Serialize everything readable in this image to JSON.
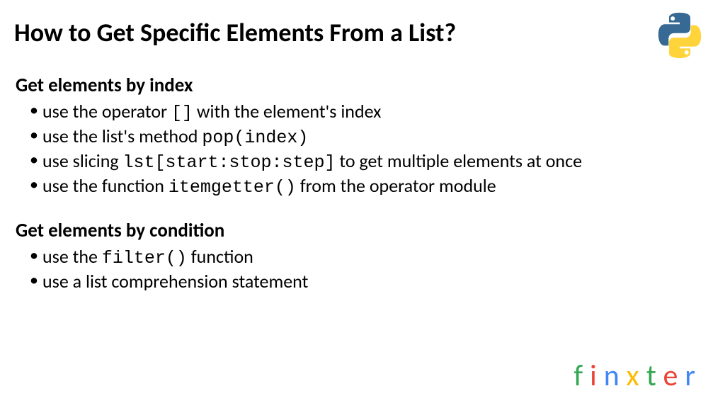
{
  "title": "How to Get Specific Elements From a List?",
  "sections": [
    {
      "heading": "Get elements by index",
      "items": [
        {
          "pre": "use the operator ",
          "code": "[]",
          "post": " with the element's index"
        },
        {
          "pre": "use the list's method ",
          "code": "pop(index)",
          "post": ""
        },
        {
          "pre": "use slicing ",
          "code": "lst[start:stop:step]",
          "post": " to get multiple elements at once"
        },
        {
          "pre": "use the function ",
          "code": "itemgetter()",
          "post": " from the operator module"
        }
      ]
    },
    {
      "heading": "Get elements by condition",
      "items": [
        {
          "pre": "use the ",
          "code": "filter()",
          "post": " function"
        },
        {
          "pre": "use a list comprehension statement",
          "code": "",
          "post": ""
        }
      ]
    }
  ],
  "brand": {
    "letters": [
      "f",
      "i",
      "n",
      "x",
      "t",
      "e",
      "r"
    ]
  },
  "logo_name": "python-logo"
}
